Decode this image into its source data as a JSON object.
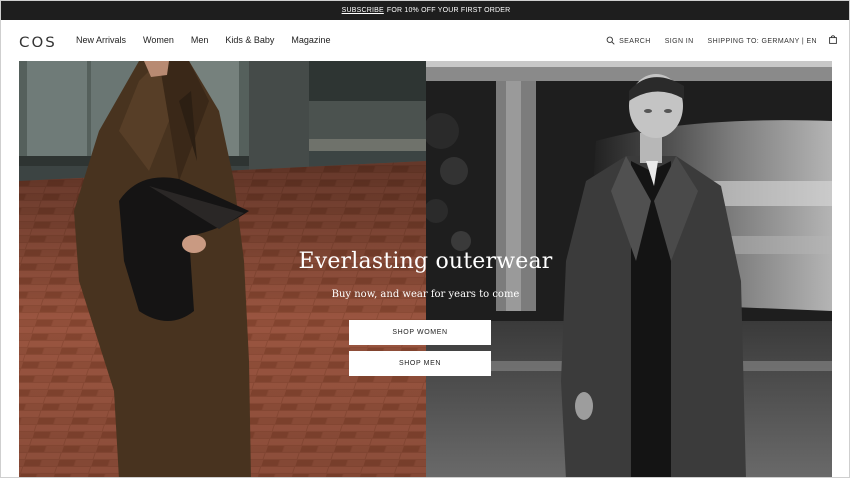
{
  "promo": {
    "link": "SUBSCRIBE",
    "text": "FOR 10% OFF YOUR FIRST ORDER"
  },
  "header": {
    "logo": "COS",
    "nav": [
      "New Arrivals",
      "Women",
      "Men",
      "Kids & Baby",
      "Magazine"
    ],
    "search_label": "SEARCH",
    "sign_in": "SIGN IN",
    "shipping": "SHIPPING TO: GERMANY | EN",
    "icons": {
      "search": "search-icon",
      "bag": "shopping-bag-icon"
    }
  },
  "hero": {
    "title": "Everlasting outerwear",
    "subtitle": "Buy now, and wear for years to come",
    "cta_women": "SHOP WOMEN",
    "cta_men": "SHOP MEN"
  },
  "colors": {
    "promo_bg": "#1e1e1e",
    "brick": "#8a4a36",
    "coat": "#4a3526",
    "bw_dark": "#2a2a2a"
  }
}
